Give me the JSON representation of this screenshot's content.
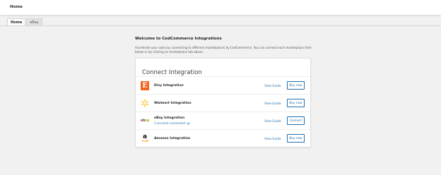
{
  "header": {
    "title": "Home"
  },
  "tabs": [
    {
      "label": "Home",
      "active": true
    },
    {
      "label": "eBay",
      "active": false
    }
  ],
  "welcome": {
    "title": "Welcome to CedCommerce Integrations",
    "description": "Accelerate your sales by connecting to different marketplaces by CedCommerce. You can connect each marketplace from below or by clicking on marketplace tab above."
  },
  "card": {
    "title": "Connect Integration",
    "integrations": [
      {
        "name": "Etsy Integration",
        "logo": "etsy-logo",
        "brand_color": "#f1641e",
        "guide_label": "View Guide",
        "action_label": "Buy now"
      },
      {
        "name": "Walmart Integration",
        "logo": "walmart-spark-logo",
        "brand_color": "#ffc220",
        "guide_label": "View Guide",
        "action_label": "Buy now"
      },
      {
        "name": "eBay Integration",
        "logo": "ebay-logo",
        "status": "1 account connected",
        "guide_label": "View Guide",
        "action_label": "Connect"
      },
      {
        "name": "Amazon Integration",
        "logo": "amazon-logo",
        "brand_color": "#ff9900",
        "guide_label": "View Guide",
        "action_label": "Buy now"
      }
    ]
  },
  "colors": {
    "accent": "#2271b1",
    "background": "#f1f1f1"
  }
}
